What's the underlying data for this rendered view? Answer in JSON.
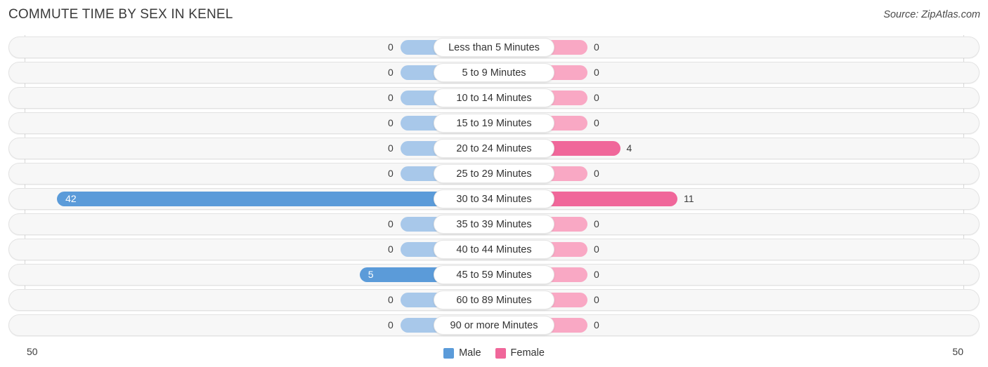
{
  "header": {
    "title": "COMMUTE TIME BY SEX IN KENEL",
    "source": "Source: ZipAtlas.com"
  },
  "axis": {
    "left_label": "50",
    "right_label": "50"
  },
  "legend": [
    {
      "label": "Male",
      "color": "#5b9bd9",
      "icon": "square-swatch"
    },
    {
      "label": "Female",
      "color": "#f0679a",
      "icon": "square-swatch"
    }
  ],
  "chart_data": {
    "type": "bar",
    "title": "COMMUTE TIME BY SEX IN KENEL",
    "subtitle": "Source: ZipAtlas.com",
    "orientation": "horizontal-diverging",
    "xlabel": "",
    "ylabel": "",
    "xlim": [
      50,
      50
    ],
    "axis_max": 50,
    "grid": true,
    "legend_position": "bottom-center",
    "categories": [
      "Less than 5 Minutes",
      "5 to 9 Minutes",
      "10 to 14 Minutes",
      "15 to 19 Minutes",
      "20 to 24 Minutes",
      "25 to 29 Minutes",
      "30 to 34 Minutes",
      "35 to 39 Minutes",
      "40 to 44 Minutes",
      "45 to 59 Minutes",
      "60 to 89 Minutes",
      "90 or more Minutes"
    ],
    "series": [
      {
        "name": "Male",
        "color": "#5b9bd9",
        "values": [
          0,
          0,
          0,
          0,
          0,
          0,
          42,
          0,
          0,
          5,
          0,
          0
        ]
      },
      {
        "name": "Female",
        "color": "#f0679a",
        "values": [
          0,
          0,
          0,
          0,
          4,
          0,
          11,
          0,
          0,
          0,
          0,
          0
        ]
      }
    ],
    "rows": [
      {
        "label": "Less than 5 Minutes",
        "male": "0",
        "female": "0"
      },
      {
        "label": "5 to 9 Minutes",
        "male": "0",
        "female": "0"
      },
      {
        "label": "10 to 14 Minutes",
        "male": "0",
        "female": "0"
      },
      {
        "label": "15 to 19 Minutes",
        "male": "0",
        "female": "0"
      },
      {
        "label": "20 to 24 Minutes",
        "male": "0",
        "female": "4"
      },
      {
        "label": "25 to 29 Minutes",
        "male": "0",
        "female": "0"
      },
      {
        "label": "30 to 34 Minutes",
        "male": "42",
        "female": "11"
      },
      {
        "label": "35 to 39 Minutes",
        "male": "0",
        "female": "0"
      },
      {
        "label": "40 to 44 Minutes",
        "male": "0",
        "female": "0"
      },
      {
        "label": "45 to 59 Minutes",
        "male": "5",
        "female": "0"
      },
      {
        "label": "60 to 89 Minutes",
        "male": "0",
        "female": "0"
      },
      {
        "label": "90 or more Minutes",
        "male": "0",
        "female": "0"
      }
    ]
  }
}
